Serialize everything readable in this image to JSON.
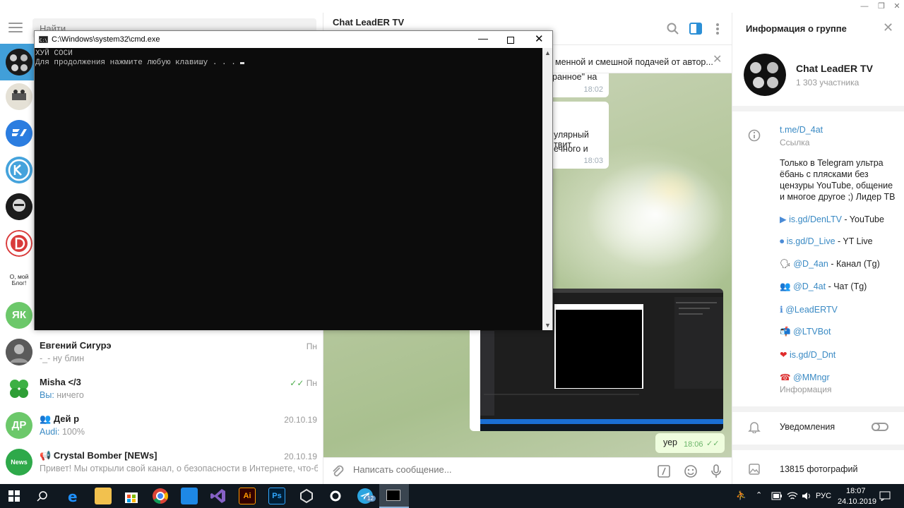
{
  "window": {
    "minimize": "—",
    "maximize": "❐",
    "close": "✕"
  },
  "sidebar": {
    "search_placeholder": "Найти...",
    "blog_avatar_text": "О, мой Блог!",
    "chats": [
      {
        "name": "Евгений Сигурэ",
        "preview": "-_- ну блин",
        "date": "Пн"
      },
      {
        "name": "Misha </3",
        "sender": "Вы:",
        "preview": "ничего",
        "date": "Пн",
        "checks": "✓✓"
      },
      {
        "name": "Дей р",
        "sender": "Audi:",
        "preview": "100%",
        "date": "20.10.19",
        "avatar": "ДР"
      },
      {
        "name": "Crystal Bomber [NEWs]",
        "preview": "Привет! Мы открыли свой канал, о безопасности в Интернете, что-бы вас ...",
        "date": "20.10.19",
        "avatar": "News"
      }
    ],
    "yak_avatar": "ЯК"
  },
  "chat": {
    "title": "Chat LeadER TV",
    "pinned_text": "менной и смешной подачей от автор...",
    "messages": [
      {
        "text": "ранное\" на",
        "time": "18:02"
      },
      {
        "line1": "улярный твит",
        "line2": "ечного и",
        "time": "18:03"
      }
    ],
    "out_message": {
      "text": "уер",
      "time": "18:06"
    },
    "compose_placeholder": "Написать сообщение..."
  },
  "cmd": {
    "title": "C:\\Windows\\system32\\cmd.exe",
    "line1": "ХУЙ СОСИ",
    "line2": "Для продолжения нажмите любую клавишу . . . "
  },
  "info": {
    "header": "Информация о группе",
    "group_name": "Chat LeadER TV",
    "members": "1 303 участника",
    "link": "t.me/D_4at",
    "link_label": "Ссылка",
    "description": [
      "Только в Telegram ультра",
      "ёбань с плясками без",
      "цензуры YouTube, общение",
      "и многое другое ;) Лидер ТВ"
    ],
    "links": [
      {
        "emoji": "▶",
        "url": "is.gd/DenLTV",
        "label": " - YouTube"
      },
      {
        "emoji": "⏺",
        "url": "is.gd/D_Live",
        "label": " - YT Live"
      },
      {
        "emoji": "🗣",
        "url": "@D_4an",
        "label": " - Канал (Tg)"
      },
      {
        "emoji": "👥",
        "url": "@D_4at",
        "label": " - Чат (Tg)"
      },
      {
        "emoji": "ℹ",
        "url": "@LeadERTV",
        "label": ""
      },
      {
        "emoji": "📬",
        "url": "@LTVBot",
        "label": ""
      },
      {
        "emoji": "❤",
        "url": "is.gd/D_Dnt",
        "label": ""
      },
      {
        "emoji": "☎",
        "url": "@MMngr",
        "label": ""
      }
    ],
    "info_label": "Информация",
    "notifications": "Уведомления",
    "photos": "13815 фотографий"
  },
  "taskbar": {
    "lang": "РУС",
    "time": "18:07",
    "date": "24.10.2019",
    "telegram_badge": "12",
    "ai_label": "Ai",
    "ps_label": "Ps"
  },
  "colors": {
    "accent": "#419fd9",
    "link": "#3a8ac4",
    "taskbar": "#101820"
  }
}
